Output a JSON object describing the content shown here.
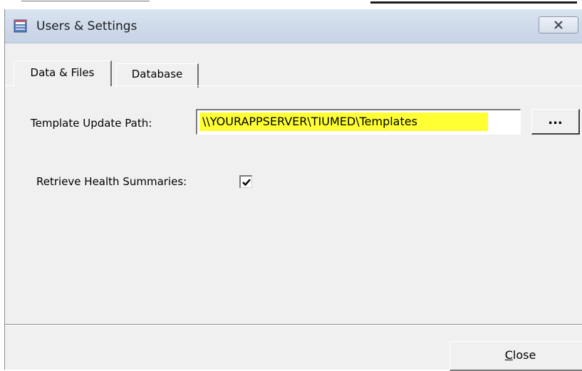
{
  "window": {
    "title": "Users & Settings",
    "title_icon": "app-window-icon",
    "close_icon": "close-x-icon"
  },
  "tabs": [
    {
      "label": "Data & Files",
      "active": true
    },
    {
      "label": "Database",
      "active": false
    }
  ],
  "fields": {
    "template_path_label": "Template Update Path:",
    "template_path_value": "\\\\YOURAPPSERVER\\TIUMED\\Templates",
    "template_path_highlight": "#ffff33",
    "browse_label": "...",
    "health_label": "Retrieve Health Summaries:",
    "health_checked": true
  },
  "footer": {
    "close_mnemonic": "C",
    "close_rest": "lose"
  }
}
